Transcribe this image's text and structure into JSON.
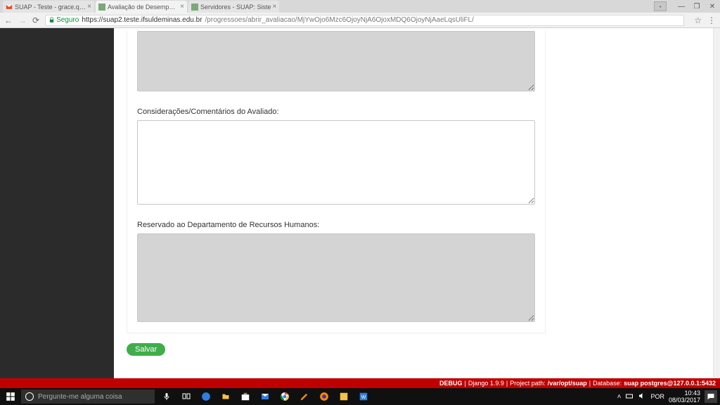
{
  "window": {
    "tabs": [
      {
        "title": "SUAP - Teste - grace.que…",
        "favicon": "gmail",
        "active": false
      },
      {
        "title": "Avaliação de Desempenh",
        "favicon": "suap",
        "active": true
      },
      {
        "title": "Servidores - SUAP: Siste",
        "favicon": "suap",
        "active": false
      }
    ],
    "controls": {
      "min": "—",
      "max": "❐",
      "close": "✕"
    }
  },
  "addr": {
    "secure_label": "Seguro",
    "host": "https://suap2.teste.ifsuldeminas.edu.br",
    "path": "/progressoes/abrir_avaliacao/MjYwOjo6Mzc6OjoyNjA6OjoxMDQ6OjoyNjAaeLqsUliFL/"
  },
  "form": {
    "field_top_value": "",
    "label_avaliado": "Considerações/Comentários do Avaliado:",
    "value_avaliado": "",
    "label_rh": "Reservado ao Departamento de Recursos Humanos:",
    "value_rh": "",
    "save_label": "Salvar"
  },
  "debug": {
    "prefix": "DEBUG",
    "django": "Django 1.9.9",
    "proj_label": "Project path:",
    "proj_path": "/var/opt/suap",
    "db_label": "Database:",
    "db_value": "suap postgres@127.0.0.1:5432"
  },
  "taskbar": {
    "search_placeholder": "Pergunte-me alguma coisa",
    "lang": "POR",
    "time": "10:43",
    "date": "08/03/2017"
  }
}
